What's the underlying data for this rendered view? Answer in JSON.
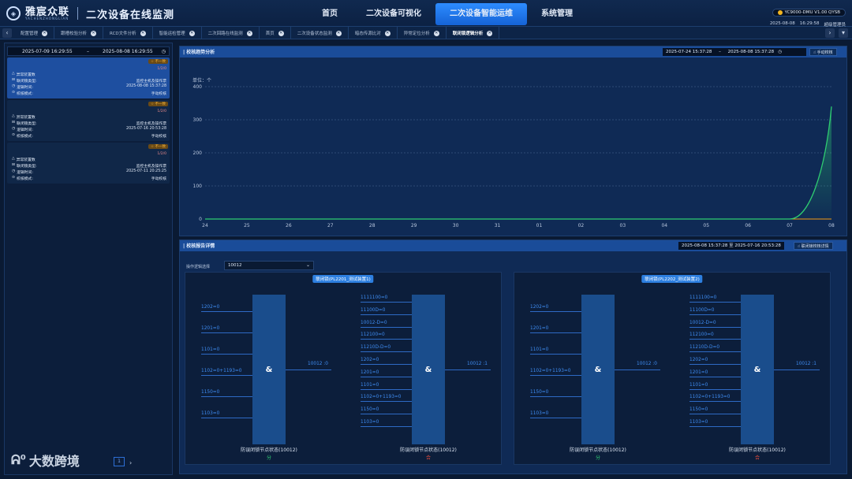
{
  "brand": {
    "name": "雅宸众联",
    "sub": "YACHENZHONGLIAN",
    "app_title": "二次设备在线监测"
  },
  "nav": [
    {
      "label": "首页",
      "active": false
    },
    {
      "label": "二次设备可视化",
      "active": false
    },
    {
      "label": "二次设备智能运维",
      "active": true
    },
    {
      "label": "系统管理",
      "active": false
    }
  ],
  "top_right": {
    "version": "YC9000-DMU V1.00 QYSB",
    "date": "2025-08-08",
    "time": "16:29:58",
    "user": "超级管理员"
  },
  "tabs": [
    {
      "label": "配置管理",
      "active": false
    },
    {
      "label": "跟槽校验分析",
      "active": false
    },
    {
      "label": "RCD文件分析",
      "active": false
    },
    {
      "label": "智能运检管理",
      "active": false
    },
    {
      "label": "二次回路在线监测",
      "active": false
    },
    {
      "label": "首页",
      "active": false
    },
    {
      "label": "二次设备状态监测",
      "active": false
    },
    {
      "label": "暗态传源比对",
      "active": false
    },
    {
      "label": "异常定位分析",
      "active": false
    },
    {
      "label": "联闭锁逻辑分析",
      "active": true
    }
  ],
  "left": {
    "date_start": "2025-07-09 16:29:55",
    "date_sep": "–",
    "date_end": "2025-08-08 16:29:55",
    "cards": [
      {
        "badge": "☆ 不一致",
        "count": "1/2/0",
        "rows": [
          {
            "k": "异常装置数",
            "v": ""
          },
          {
            "k": "联闭锁类型:",
            "v": "监控主机及操作票"
          },
          {
            "k": "逻辑时间:",
            "v": "2025-08-08 15:37:28"
          },
          {
            "k": "校核模式:",
            "v": "手动校核"
          }
        ]
      },
      {
        "badge": "☆ 不一致",
        "count": "1/2/0",
        "rows": [
          {
            "k": "异常装置数",
            "v": ""
          },
          {
            "k": "联闭锁类型:",
            "v": "监控主机及操作票"
          },
          {
            "k": "逻辑时间:",
            "v": "2025-07-16 20:53:28"
          },
          {
            "k": "校核模式:",
            "v": "手动校核"
          }
        ]
      },
      {
        "badge": "☆ 不一致",
        "count": "1/2/0",
        "rows": [
          {
            "k": "异常装置数",
            "v": ""
          },
          {
            "k": "联闭锁类型:",
            "v": "监控主机及操作票"
          },
          {
            "k": "逻辑时间:",
            "v": "2025-07-11 20:25:25"
          },
          {
            "k": "校核模式:",
            "v": "手动校核"
          }
        ]
      }
    ],
    "page": "1",
    "watermark": "大数跨境"
  },
  "trend": {
    "title": "| 校核趋势分析",
    "date_start": "2025-07-24 15:37:28",
    "date_sep": "–",
    "date_end": "2025-08-08 15:37:28",
    "button": "手动校核",
    "unit": "单位：个"
  },
  "chart_data": {
    "type": "line",
    "categories": [
      "24",
      "25",
      "26",
      "27",
      "28",
      "29",
      "30",
      "31",
      "01",
      "02",
      "03",
      "04",
      "05",
      "06",
      "07",
      "08"
    ],
    "yticks": [
      0,
      100,
      200,
      300,
      400
    ],
    "ylim": [
      0,
      400
    ],
    "grid": true,
    "series": [
      {
        "values": [
          0,
          0,
          0,
          0,
          0,
          0,
          0,
          0,
          0,
          0,
          0,
          0,
          0,
          0,
          0,
          340
        ],
        "color": "#2ecc71"
      },
      {
        "values": [
          0,
          0,
          0,
          0,
          0,
          0,
          0,
          0,
          0,
          0,
          0,
          0,
          0,
          0,
          0,
          0
        ],
        "color": "#f39c12"
      }
    ]
  },
  "detail": {
    "title": "| 校核报告详情",
    "date_range": "2025-08-08 15:37:28 至 2025-07-16 20:53:28",
    "button": "联闭锁校核详情",
    "select_label": "操作逻辑选择",
    "select_value": "10012"
  },
  "diagrams": [
    {
      "title": "联闭锁(PL2201_测试装置1)",
      "gates": [
        {
          "inputs": [
            "1202=0",
            "1201=0",
            "1101=0",
            "1102=0+1193=0",
            "1150=0",
            "1103=0"
          ],
          "output": "10012 :0",
          "caption": "防误闭锁节点状态(10012)",
          "state": "分",
          "state_color": "#2ecc71"
        },
        {
          "inputs": [
            "1111100=0",
            "11100D=0",
            "10012-D=0",
            "112100=0",
            "11210D-D=0",
            "1202=0",
            "1201=0",
            "1101=0",
            "1102=0+1193=0",
            "1150=0",
            "1103=0"
          ],
          "output": "10012 :1",
          "caption": "防误闭锁节点状态(10012)",
          "state": "合",
          "state_color": "#e74c3c"
        }
      ]
    },
    {
      "title": "联闭锁(PL2202_测试装置2)",
      "gates": [
        {
          "inputs": [
            "1202=0",
            "1201=0",
            "1101=0",
            "1102=0+1193=0",
            "1150=0",
            "1103=0"
          ],
          "output": "10012 :0",
          "caption": "防误闭锁节点状态(10012)",
          "state": "分",
          "state_color": "#2ecc71"
        },
        {
          "inputs": [
            "1111100=0",
            "11100D=0",
            "10012-D=0",
            "112100=0",
            "11210D-D=0",
            "1202=0",
            "1201=0",
            "1101=0",
            "1102=0+1193=0",
            "1150=0",
            "1103=0"
          ],
          "output": "10012 :1",
          "caption": "防误闭锁节点状态(10012)",
          "state": "合",
          "state_color": "#e74c3c"
        }
      ]
    }
  ],
  "colors": {
    "accent": "#2d8cff",
    "panel": "#0f2a55",
    "line_green": "#2ecc71",
    "line_orange": "#f39c12"
  }
}
